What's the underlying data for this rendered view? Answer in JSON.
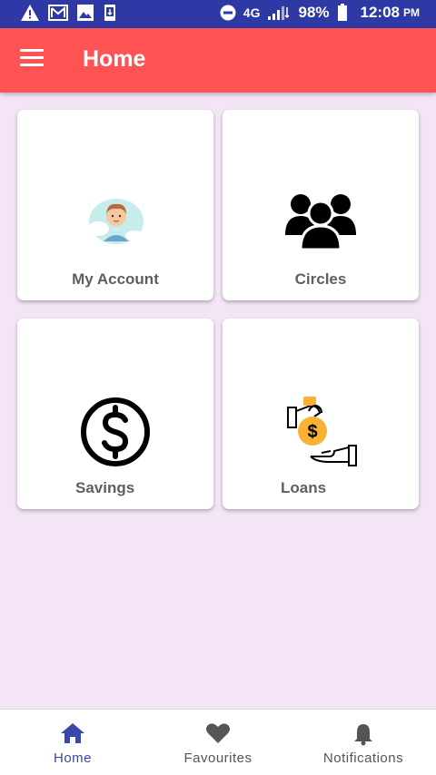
{
  "status_bar": {
    "network": "4G",
    "battery": "98%",
    "time": "12:08",
    "ampm": "PM"
  },
  "toolbar": {
    "title": "Home",
    "menu_icon": "hamburger-menu-icon",
    "background": "#ff5252"
  },
  "cards": [
    {
      "label": "My Account",
      "icon": "user-avatar-icon"
    },
    {
      "label": "Circles",
      "icon": "group-people-icon"
    },
    {
      "label": "Savings",
      "icon": "dollar-circle-icon"
    },
    {
      "label": "Loans",
      "icon": "money-bag-hand-icon"
    }
  ],
  "bottom_nav": {
    "items": [
      {
        "label": "Home",
        "icon": "home-icon",
        "active": true
      },
      {
        "label": "Favourites",
        "icon": "heart-icon",
        "active": false
      },
      {
        "label": "Notifications",
        "icon": "bell-icon",
        "active": false
      }
    ],
    "active_color": "#3949ab"
  },
  "colors": {
    "status_bar": "#2e39a6",
    "background": "#f3e5f5",
    "loans_bag": "#f9b233"
  }
}
